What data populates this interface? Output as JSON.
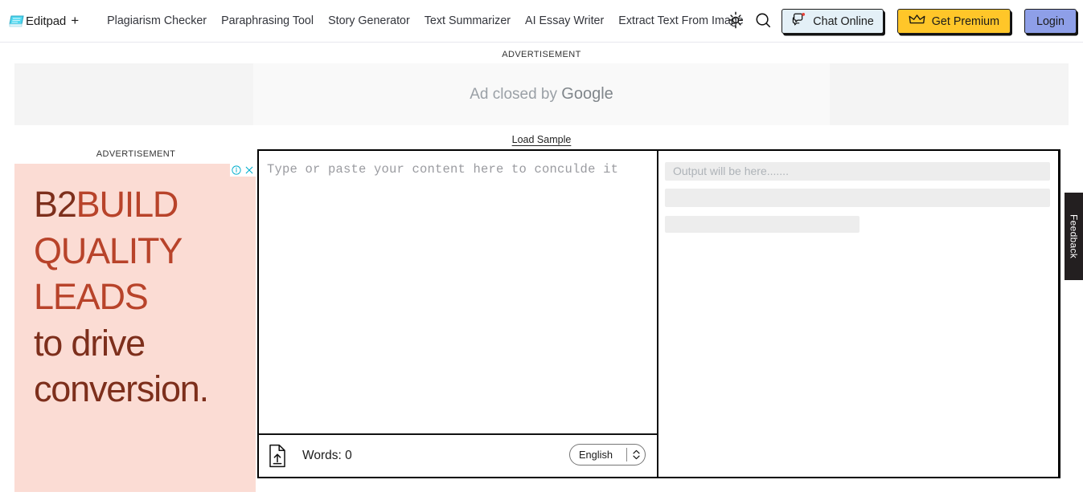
{
  "header": {
    "brand": {
      "name": "Editpad",
      "plus": "+",
      "icon": "notepad-icon"
    },
    "nav": [
      {
        "label": "Plagiarism Checker"
      },
      {
        "label": "Paraphrasing Tool"
      },
      {
        "label": "Story Generator"
      },
      {
        "label": "Text Summarizer"
      },
      {
        "label": "AI Essay Writer"
      },
      {
        "label": "Extract Text From Image"
      }
    ],
    "actions": {
      "theme_icon": "sun-icon",
      "search_icon": "search-icon",
      "chat_label": "Chat Online",
      "chat_icon": "chat-bubble-icon",
      "premium_label": "Get Premium",
      "premium_icon": "crown-icon",
      "login_label": "Login"
    },
    "colors": {
      "chat_bg": "#e4f0f7",
      "premium_bg": "#ffc629",
      "login_bg": "#8e9fe8",
      "outline": "#1b1b1b"
    }
  },
  "top_ad": {
    "label": "ADVERTISEMENT",
    "closed_text": "Ad closed by ",
    "closed_brand": "Google"
  },
  "toolbar": {
    "load_sample": "Load Sample"
  },
  "side_ad": {
    "label": "ADVERTISEMENT",
    "info_icon": "adchoices-info-icon",
    "close_icon": "close-icon",
    "line1_prefix": "B2",
    "line1": "BUILD",
    "line2": "QUALITY",
    "line3": "LEADS",
    "line4": "to drive",
    "line5": "conversion.",
    "bg_color": "#fbdcd4",
    "accent_color": "#b8432a",
    "dark_color": "#7d2f1c"
  },
  "editor": {
    "placeholder": "Type or paste your content here to conculde it",
    "value": "",
    "upload_icon": "upload-file-icon",
    "words_label": "Words: 0",
    "language": "English",
    "language_chevron": "chevron-updown-icon"
  },
  "output": {
    "placeholder": "Output will be here......."
  },
  "feedback": {
    "label": "Feedback"
  }
}
